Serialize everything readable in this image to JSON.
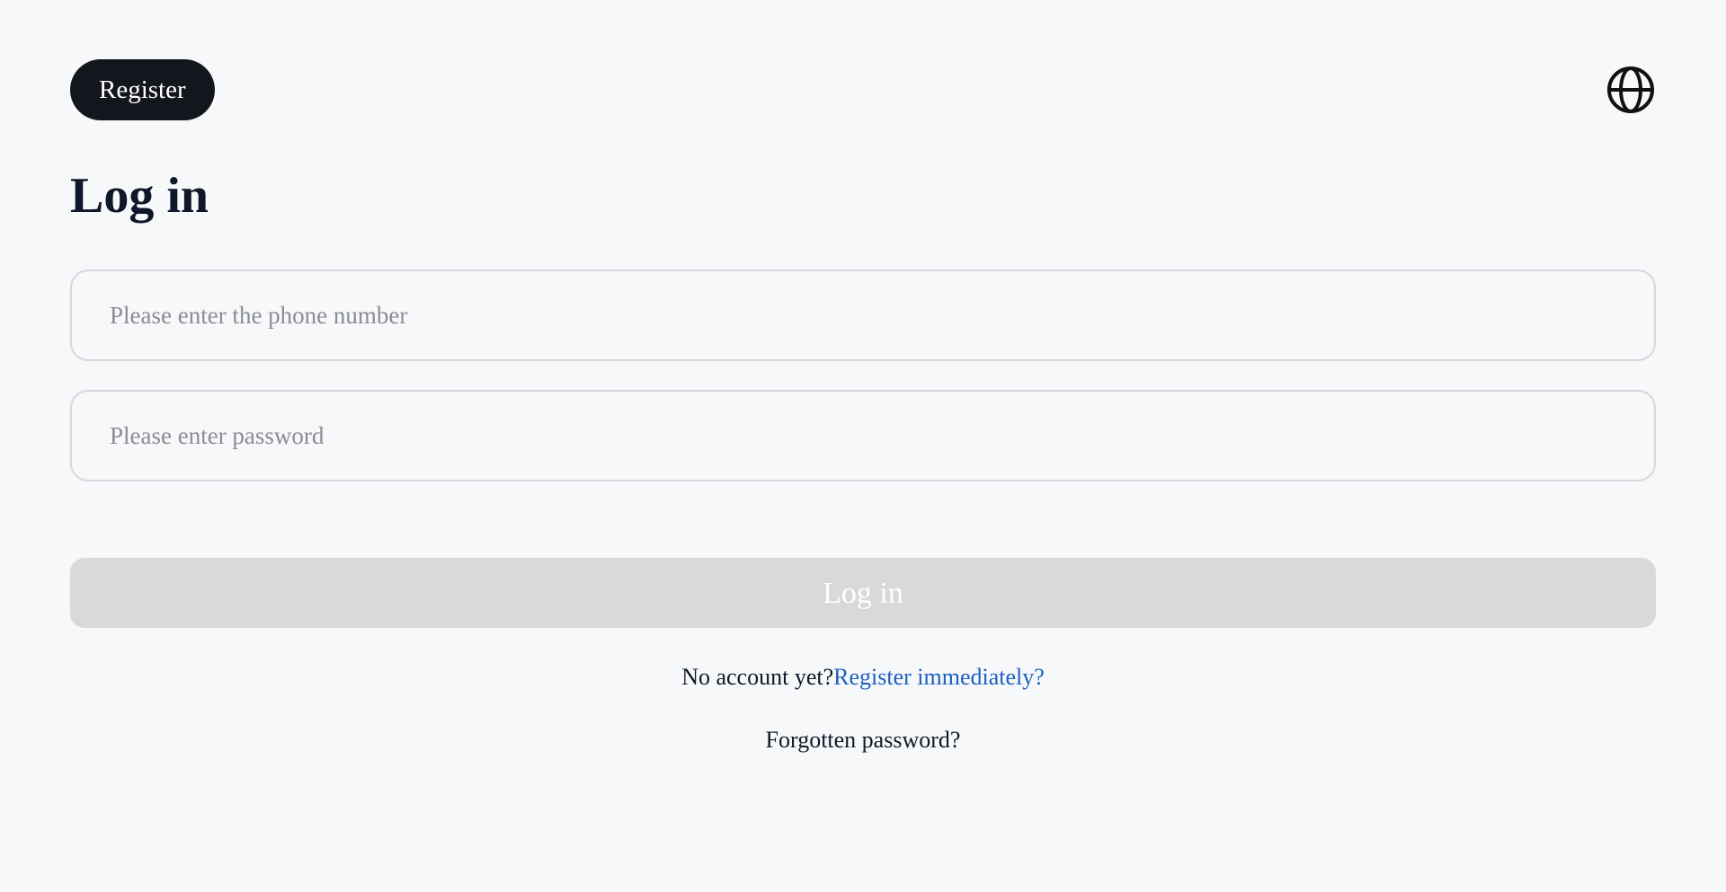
{
  "header": {
    "register_label": "Register",
    "language_icon": "globe-icon"
  },
  "login": {
    "title": "Log in",
    "phone_placeholder": "Please enter the phone number",
    "password_placeholder": "Please enter password",
    "submit_label": "Log in",
    "no_account_text": "No account yet?",
    "register_link": "Register immediately?",
    "forgot_password": "Forgotten password?"
  },
  "colors": {
    "background": "#f7f8fa",
    "register_button": "#14161d",
    "login_button_disabled": "#d9d9d9",
    "link": "#1d5fbf",
    "title": "#0f172a"
  }
}
